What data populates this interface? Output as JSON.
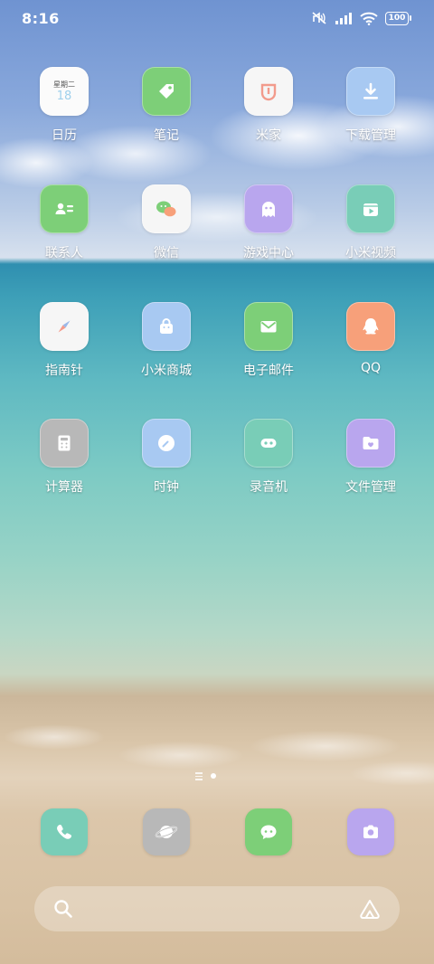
{
  "status_bar": {
    "time": "8:16",
    "battery": "100",
    "icons": [
      "mute-icon",
      "signal-icon",
      "wifi-icon",
      "battery-icon"
    ]
  },
  "apps": [
    {
      "label": "日历",
      "icon": "calendar-icon",
      "color": "#fbfbfb",
      "calendar_weekday": "星期二",
      "calendar_day": "18"
    },
    {
      "label": "笔记",
      "icon": "tag-icon",
      "color": "#7dcf78"
    },
    {
      "label": "米家",
      "icon": "mijia-icon",
      "color": "#f6f6f6"
    },
    {
      "label": "下载管理",
      "icon": "download-icon",
      "color": "#a8c9f2"
    },
    {
      "label": "联系人",
      "icon": "contact-card-icon",
      "color": "#7dcf78"
    },
    {
      "label": "微信",
      "icon": "wechat-icon",
      "color": "#f6f6f6"
    },
    {
      "label": "游戏中心",
      "icon": "ghost-icon",
      "color": "#b9a6ee"
    },
    {
      "label": "小米视频",
      "icon": "video-icon",
      "color": "#79cdb7"
    },
    {
      "label": "指南针",
      "icon": "compass-icon",
      "color": "#f6f6f6"
    },
    {
      "label": "小米商城",
      "icon": "shopping-bag-icon",
      "color": "#a8c9f2"
    },
    {
      "label": "电子邮件",
      "icon": "mail-icon",
      "color": "#7dcf78"
    },
    {
      "label": "QQ",
      "icon": "penguin-icon",
      "color": "#f7a07a"
    },
    {
      "label": "计算器",
      "icon": "calculator-icon",
      "color": "#b8b8b8"
    },
    {
      "label": "时钟",
      "icon": "clock-icon",
      "color": "#a8c9f2"
    },
    {
      "label": "录音机",
      "icon": "recorder-icon",
      "color": "#79cdb7"
    },
    {
      "label": "文件管理",
      "icon": "folder-icon",
      "color": "#b9a6ee"
    }
  ],
  "dock": [
    {
      "name": "phone",
      "icon": "phone-icon",
      "color": "#79cdb7"
    },
    {
      "name": "browser",
      "icon": "planet-icon",
      "color": "#b8b8b8"
    },
    {
      "name": "messages",
      "icon": "message-bubble-icon",
      "color": "#7dcf78"
    },
    {
      "name": "camera",
      "icon": "camera-icon",
      "color": "#b9a6ee"
    }
  ],
  "page_indicator": {
    "pages": 1,
    "current": 1
  },
  "search": {
    "icon": "search-icon",
    "assistant_icon": "assistant-icon"
  }
}
